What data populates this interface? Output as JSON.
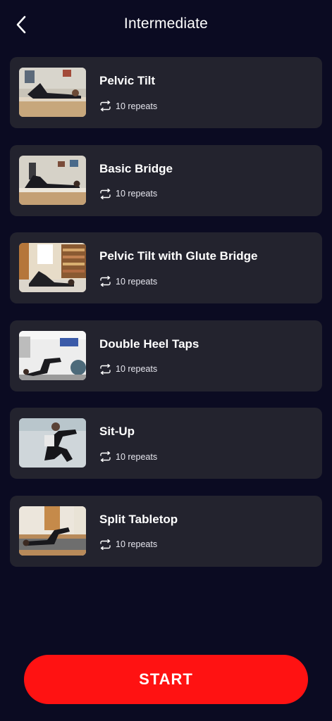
{
  "header": {
    "title": "Intermediate"
  },
  "exercises": [
    {
      "name": "Pelvic Tilt",
      "repeats": "10 repeats"
    },
    {
      "name": "Basic Bridge",
      "repeats": "10 repeats"
    },
    {
      "name": "Pelvic Tilt with Glute Bridge",
      "repeats": "10 repeats"
    },
    {
      "name": "Double Heel Taps",
      "repeats": "10 repeats"
    },
    {
      "name": "Sit-Up",
      "repeats": "10 repeats"
    },
    {
      "name": "Split Tabletop",
      "repeats": "10 repeats"
    }
  ],
  "footer": {
    "start_label": "START"
  },
  "colors": {
    "background": "#0b0b22",
    "card": "#23232e",
    "accent": "#ff1212"
  }
}
